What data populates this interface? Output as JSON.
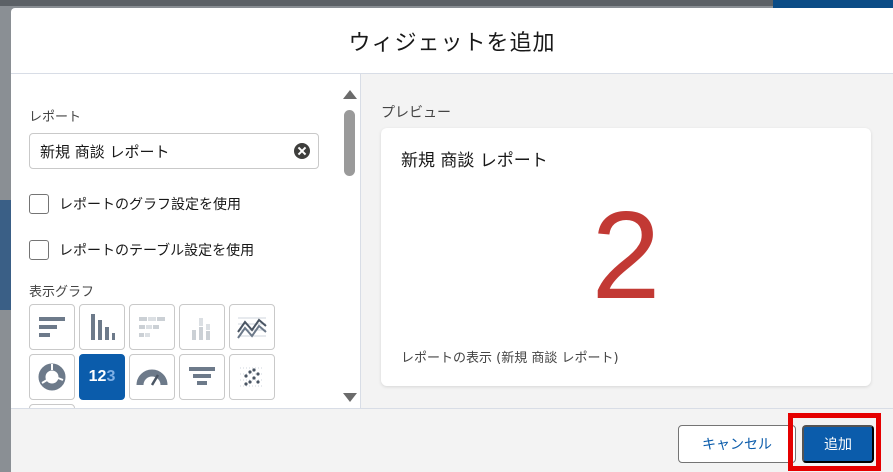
{
  "modal": {
    "title": "ウィジェットを追加"
  },
  "left": {
    "report_label": "レポート",
    "report_value": "新規 商談 レポート",
    "use_report_chart_label": "レポートのグラフ設定を使用",
    "use_report_table_label": "レポートのテーブル設定を使用",
    "display_chart_label": "表示グラフ",
    "chart_types": [
      {
        "icon": "horizontal-bar-icon",
        "state": "normal"
      },
      {
        "icon": "vertical-bar-icon",
        "state": "normal"
      },
      {
        "icon": "stacked-horizontal-bar-icon",
        "state": "disabled"
      },
      {
        "icon": "stacked-vertical-bar-icon",
        "state": "disabled"
      },
      {
        "icon": "line-chart-icon",
        "state": "normal"
      },
      {
        "icon": "donut-chart-icon",
        "state": "normal"
      },
      {
        "icon": "metric-icon",
        "state": "selected",
        "text_main": "12",
        "text_dim": "3"
      },
      {
        "icon": "gauge-icon",
        "state": "normal"
      },
      {
        "icon": "funnel-icon",
        "state": "normal"
      },
      {
        "icon": "scatter-icon",
        "state": "normal"
      },
      {
        "icon": "table-icon",
        "state": "normal"
      }
    ]
  },
  "preview": {
    "label": "プレビュー",
    "card_title": "新規 商談 レポート",
    "metric_value": "2",
    "footer": "レポートの表示 (新規 商談 レポート)"
  },
  "footer": {
    "cancel_label": "キャンセル",
    "add_label": "追加"
  },
  "colors": {
    "brand": "#0b5cab",
    "metric": "#c23934",
    "highlight": "#e50000"
  }
}
